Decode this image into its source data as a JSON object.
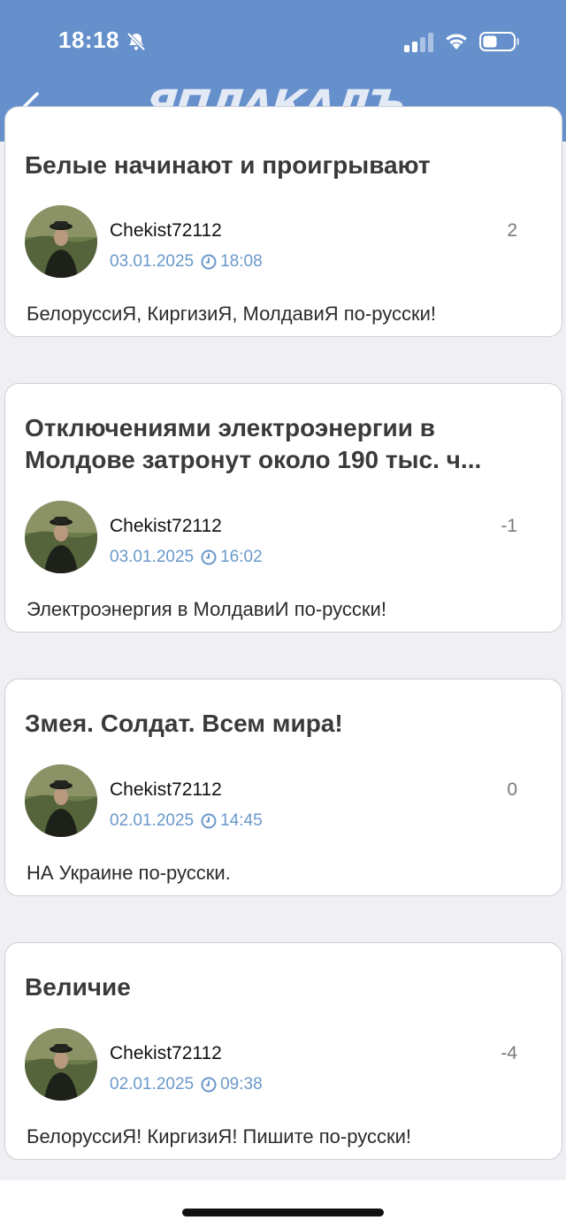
{
  "status_bar": {
    "time": "18:18"
  },
  "header": {
    "logo_text": "ЯПЛАКАЛЪ"
  },
  "posts": [
    {
      "title": "Белые начинают и проигрывают",
      "author": "Chekist72112",
      "date": "03.01.2025",
      "time": "18:08",
      "score": "2",
      "comment": "БелоруссиЯ, КиргизиЯ, МолдавиЯ по-русски!"
    },
    {
      "title": "Отключениями электроэнергии в Молдове затронут около 190 тыс. ч...",
      "author": "Chekist72112",
      "date": "03.01.2025",
      "time": "16:02",
      "score": "-1",
      "comment": "Электроэнергия в МолдавиИ по-русски!"
    },
    {
      "title": "Змея. Солдат. Всем мира!",
      "author": "Chekist72112",
      "date": "02.01.2025",
      "time": "14:45",
      "score": "0",
      "comment": "НА Украине по-русски."
    },
    {
      "title": "Величие",
      "author": "Chekist72112",
      "date": "02.01.2025",
      "time": "09:38",
      "score": "-4",
      "comment": "БелоруссиЯ! КиргизиЯ! Пишите по-русски!"
    }
  ]
}
